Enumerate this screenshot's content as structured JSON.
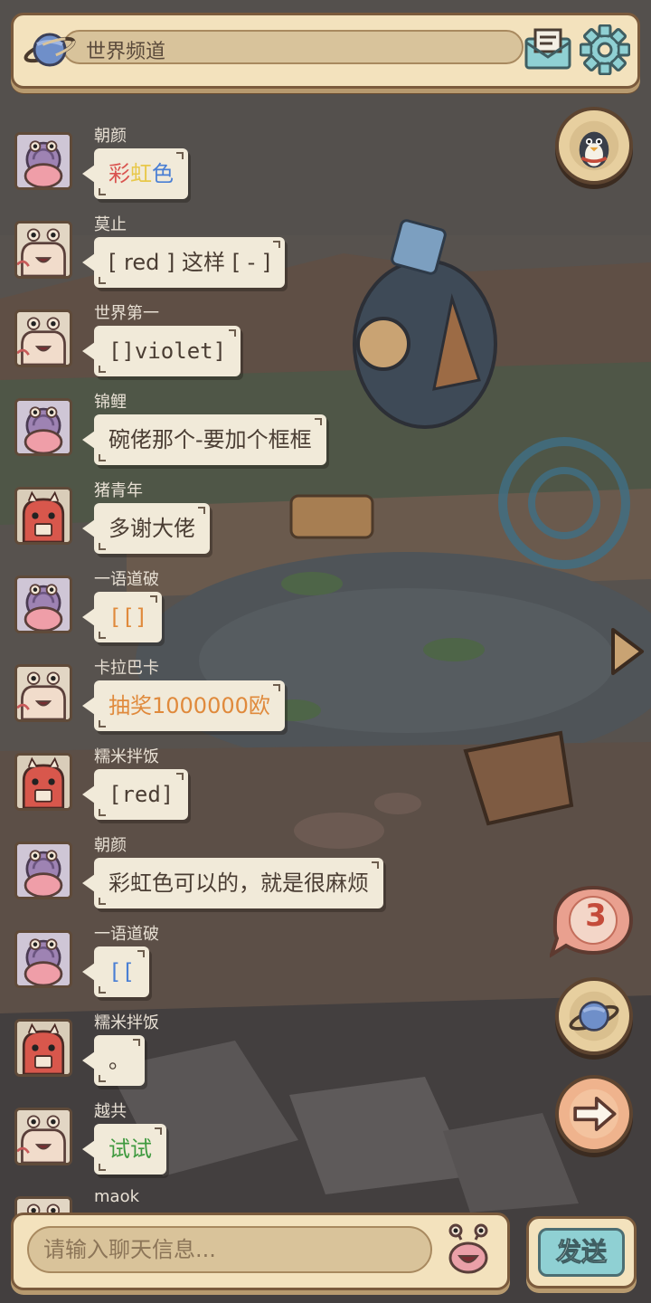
{
  "topbar": {
    "channel_title": "世界频道",
    "planet_icon": "planet-icon",
    "mail_icon": "mail-icon",
    "settings_icon": "gear-icon"
  },
  "messages": [
    {
      "user": "朝颜",
      "avatar": "snail-pink",
      "segments": [
        {
          "text": "彩",
          "color": "#d9534f"
        },
        {
          "text": "虹",
          "color": "#e8c84a"
        },
        {
          "text": "色",
          "color": "#4a7fd4"
        }
      ]
    },
    {
      "user": "莫止",
      "avatar": "snail-plain",
      "segments": [
        {
          "text": "[ red ] 这样 [ - ]",
          "color": "#4a3d33"
        }
      ]
    },
    {
      "user": "世界第一",
      "avatar": "snail-plain",
      "segments": [
        {
          "text": "[]violet]",
          "color": "#4a3d33"
        }
      ]
    },
    {
      "user": "锦鲤",
      "avatar": "snail-pink",
      "segments": [
        {
          "text": "碗佬那个-要加个框框",
          "color": "#4a3d33"
        }
      ]
    },
    {
      "user": "猪青年",
      "avatar": "red-creature",
      "segments": [
        {
          "text": "多谢大佬",
          "color": "#4a3d33"
        }
      ]
    },
    {
      "user": "一语道破",
      "avatar": "snail-pink",
      "segments": [
        {
          "text": "[[]",
          "color": "#e08a3c"
        }
      ]
    },
    {
      "user": "卡拉巴卡",
      "avatar": "snail-plain",
      "segments": [
        {
          "text": "抽奖1000000欧",
          "color": "#e08a3c"
        }
      ]
    },
    {
      "user": "糯米拌饭",
      "avatar": "red-creature",
      "segments": [
        {
          "text": "[red]",
          "color": "#4a3d33"
        }
      ]
    },
    {
      "user": "朝颜",
      "avatar": "snail-pink",
      "segments": [
        {
          "text": "彩虹色可以的，就是很麻烦",
          "color": "#4a3d33"
        }
      ]
    },
    {
      "user": "一语道破",
      "avatar": "snail-pink",
      "segments": [
        {
          "text": "[[",
          "color": "#4a7fd4"
        }
      ]
    },
    {
      "user": "糯米拌饭",
      "avatar": "red-creature",
      "segments": [
        {
          "text": "。",
          "color": "#4a3d33"
        }
      ]
    },
    {
      "user": "越共",
      "avatar": "snail-plain",
      "segments": [
        {
          "text": "试试",
          "color": "#3f9a3f"
        }
      ]
    },
    {
      "user": "maok",
      "avatar": "snail-plain",
      "segments": []
    }
  ],
  "side_buttons": {
    "penguin": "penguin-icon",
    "badge_count": "3",
    "planet": "planet-icon",
    "arrow": "arrow-right-icon",
    "play": "play-icon"
  },
  "bottombar": {
    "input_placeholder": "请输入聊天信息...",
    "emoji_icon": "snail-emoji-icon",
    "send_label": "发送"
  }
}
